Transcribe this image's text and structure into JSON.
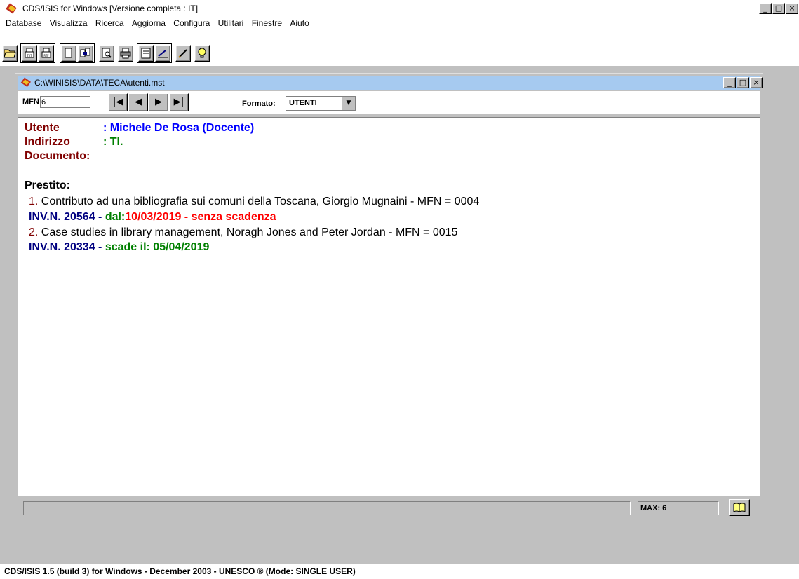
{
  "app": {
    "title": "CDS/ISIS for Windows [Versione completa : IT]",
    "window_controls": [
      "_",
      "□",
      "×"
    ]
  },
  "menu": [
    "Database",
    "Visualizza",
    "Ricerca",
    "Aggiorna",
    "Configura",
    "Utilitari",
    "Finestre",
    "Aiuto"
  ],
  "toolbar": {
    "icons": [
      "open-folder-icon",
      "print-txt-icon",
      "print-rtf-icon",
      "copy-icon",
      "copy-records-icon",
      "preview-icon",
      "printer-icon",
      "form-icon",
      "edit-pen-icon",
      "pencil-icon",
      "lightbulb-icon"
    ]
  },
  "child_window": {
    "title": "C:\\WINISIS\\DATA\\TECA\\utenti.mst",
    "window_controls": [
      "_",
      "□",
      "×"
    ],
    "mfn_label": "MFN",
    "mfn_value": "6",
    "nav_buttons": [
      "|◀",
      "◀",
      "▶",
      "▶|"
    ],
    "formato_label": "Formato:",
    "formato_value": "UTENTI"
  },
  "record": {
    "utente_label": "Utente",
    "utente_value": ": Michele De Rosa (Docente)",
    "indirizzo_label": "Indirizzo",
    "indirizzo_value": ": TI.",
    "documento_label": "Documento:",
    "prestito_label": "Prestito:",
    "loans": [
      {
        "num": "1.",
        "title": " Contributo ad una bibliografia sui comuni della Toscana, Giorgio Mugnaini - MFN = 0004",
        "inv": "INV.N. 20564 - ",
        "date_prefix": " dal:",
        "date_value": "10/03/2019 - senza scadenza"
      },
      {
        "num": "2.",
        "title": " Case studies in library management, Noragh Jones and Peter Jordan - MFN = 0015",
        "inv": "INV.N. 20334 - ",
        "date_prefix": " scade il: 05/04/2019",
        "date_value": ""
      }
    ]
  },
  "status": {
    "max": "MAX: 6",
    "bottom": "CDS/ISIS 1.5 (build 3) for Windows - December 2003 - UNESCO ® (Mode: SINGLE USER)"
  },
  "colors": {
    "label": "#800000",
    "name": "#0000ff",
    "inv": "#000080",
    "ok": "#008000",
    "alert": "#ff0000",
    "child_title_bg": "#a6caf0"
  }
}
